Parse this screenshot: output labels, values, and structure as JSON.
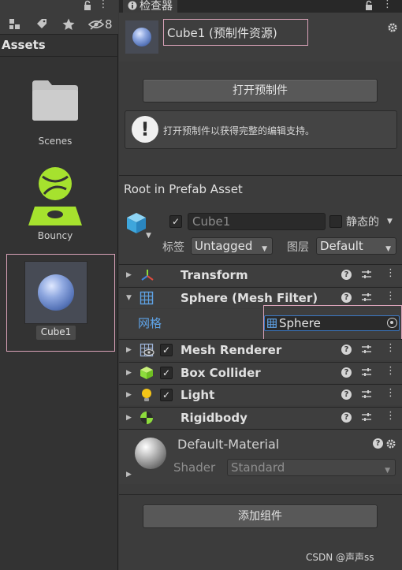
{
  "project": {
    "toolbar_hidden_count": "8",
    "folder_title": "Assets",
    "assets": [
      {
        "label": "Scenes"
      },
      {
        "label": "Bouncy"
      },
      {
        "label": "Cube1"
      }
    ]
  },
  "inspector": {
    "tab_title": "检查器",
    "header_title": "Cube1 (预制件资源)",
    "open_prefab_label": "打开预制件",
    "info_text": "打开预制件以获得完整的编辑支持。",
    "root_label": "Root in Prefab Asset",
    "gameobject": {
      "name": "Cube1",
      "active": true,
      "static_label": "静态的",
      "tag_label": "标签",
      "tag_value": "Untagged",
      "layer_label": "图层",
      "layer_value": "Default"
    },
    "components": [
      {
        "name": "Transform",
        "icon": "transform-icon",
        "has_checkbox": false,
        "expanded": false
      },
      {
        "name": "Sphere (Mesh Filter)",
        "icon": "mesh-filter-icon",
        "has_checkbox": false,
        "expanded": true
      },
      {
        "name": "Mesh Renderer",
        "icon": "mesh-renderer-icon",
        "has_checkbox": true,
        "expanded": false
      },
      {
        "name": "Box Collider",
        "icon": "box-collider-icon",
        "has_checkbox": true,
        "expanded": false
      },
      {
        "name": "Light",
        "icon": "light-icon",
        "has_checkbox": true,
        "expanded": false
      },
      {
        "name": "Rigidbody",
        "icon": "rigidbody-icon",
        "has_checkbox": false,
        "expanded": false
      }
    ],
    "mesh_filter": {
      "label": "网格",
      "value": "Sphere"
    },
    "material": {
      "name": "Default-Material",
      "shader_label": "Shader",
      "shader_value": "Standard"
    },
    "add_component_label": "添加组件"
  },
  "watermark": "CSDN @声声ss",
  "colors": {
    "background": "#383838",
    "panel": "#3c3c3c",
    "highlight_border": "#d9a2b8",
    "link_blue": "#5fa3e6",
    "bouncy_green": "#a6e22e"
  }
}
